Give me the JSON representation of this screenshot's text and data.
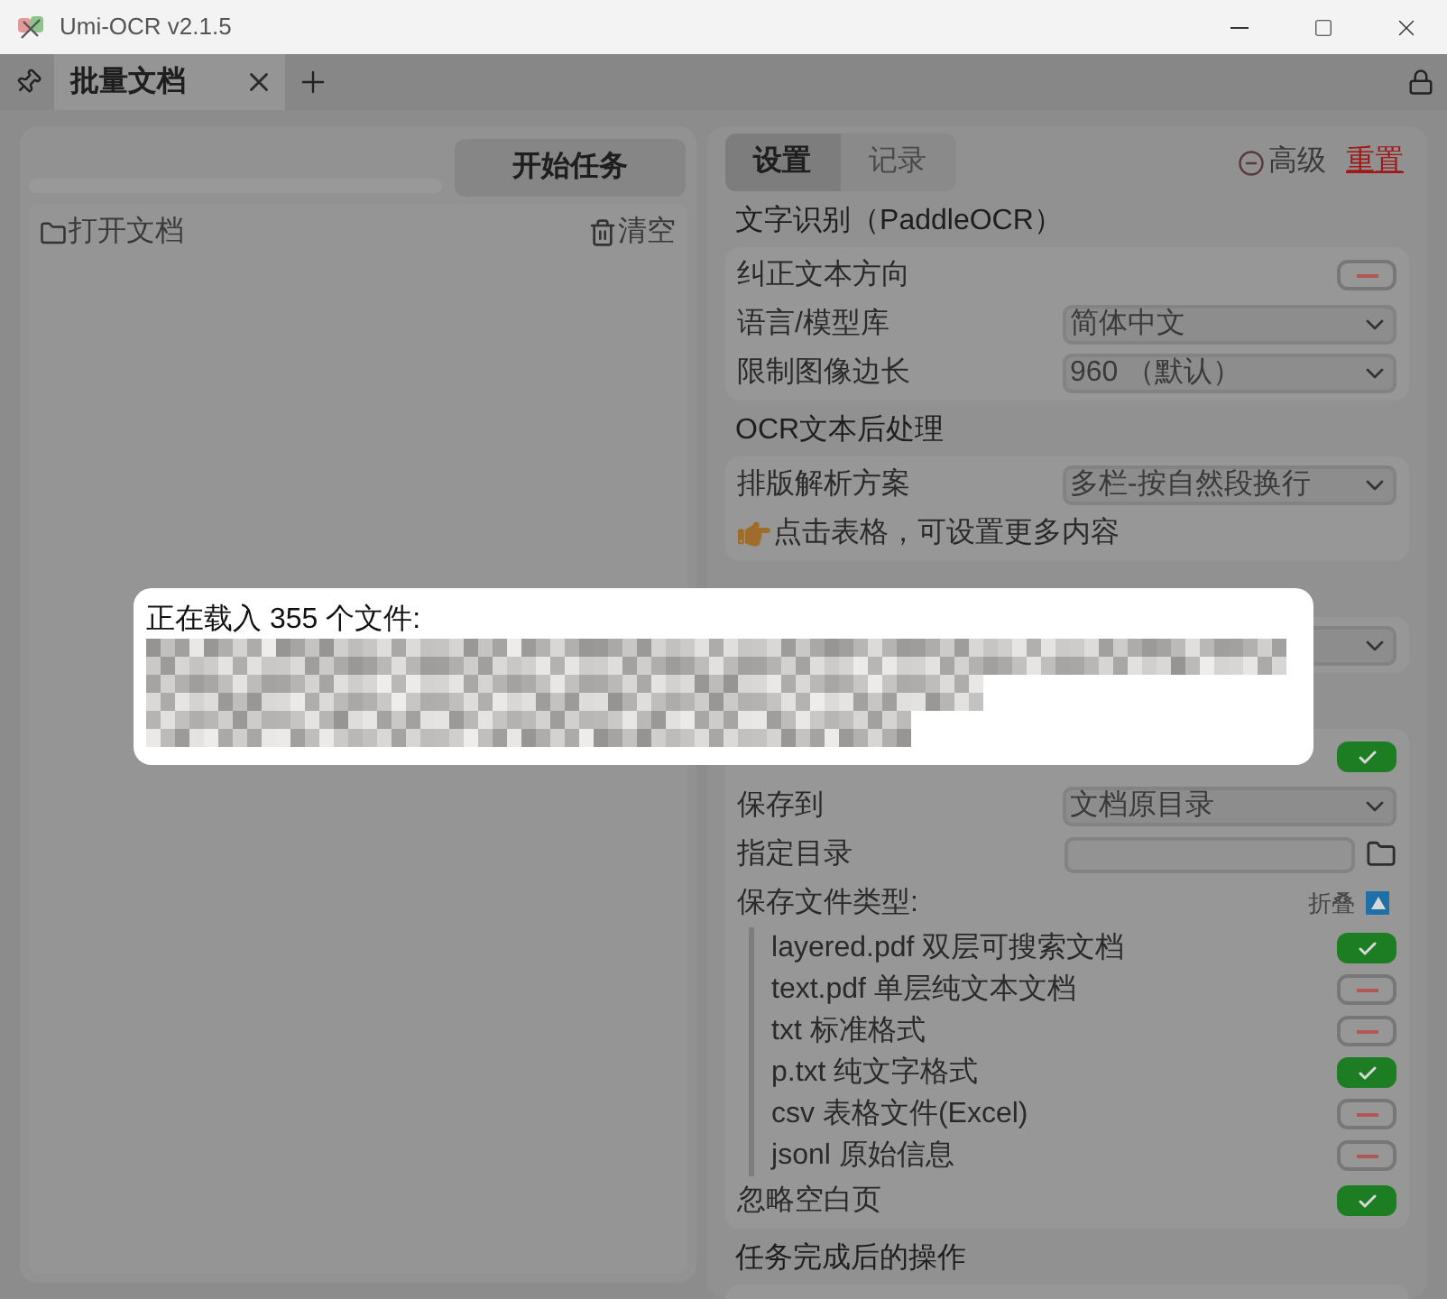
{
  "window": {
    "title": "Umi-OCR v2.1.5"
  },
  "tabs": [
    {
      "label": "批量文档",
      "selected": true
    }
  ],
  "task_panel": {
    "start_button": "开始任务",
    "progress": {
      "level": 0
    },
    "open_button": "打开文档",
    "clear_button": "清空"
  },
  "settings": {
    "tabs": [
      {
        "label": "设置",
        "selected": true
      },
      {
        "label": "记录",
        "selected": false
      }
    ],
    "advanced": "高级",
    "reset": "重置",
    "sections": [
      {
        "title": "文字识别（PaddleOCR）",
        "items": [
          {
            "kind": "toggle",
            "label": "纠正文本方向",
            "checked": false
          },
          {
            "kind": "select",
            "label": "语言/模型库",
            "value": "简体中文"
          },
          {
            "kind": "select",
            "label": "限制图像边长",
            "value": "960 （默认）"
          }
        ]
      },
      {
        "title": "OCR文本后处理",
        "items": [
          {
            "kind": "select",
            "label": "排版解析方案",
            "value": "多栏-按自然段换行"
          },
          {
            "kind": "hint",
            "text": "点击表格，可设置更多内容"
          }
        ]
      },
      {
        "items": [
          {
            "kind": "select"
          }
        ]
      },
      {
        "items": [
          {
            "kind": "toggle",
            "checked": true
          },
          {
            "kind": "select",
            "label": "保存到",
            "value": "文档原目录"
          },
          {
            "kind": "path",
            "label": "指定目录"
          },
          {
            "kind": "group",
            "label": "保存文件类型:",
            "action": "折叠",
            "expanded": true,
            "children": [
              {
                "kind": "toggle",
                "label": "layered.pdf 双层可搜索文档",
                "checked": true
              },
              {
                "kind": "toggle",
                "label": "text.pdf 单层纯文本文档",
                "checked": false
              },
              {
                "kind": "toggle",
                "label": "txt 标准格式",
                "checked": false
              },
              {
                "kind": "toggle",
                "label": "p.txt 纯文字格式",
                "checked": true
              },
              {
                "kind": "toggle",
                "label": "csv 表格文件(Excel)",
                "checked": false
              },
              {
                "kind": "toggle",
                "label": "jsonl 原始信息",
                "checked": false
              }
            ]
          },
          {
            "kind": "toggle",
            "label": "忽略空白页",
            "checked": true
          }
        ]
      },
      {
        "title": "任务完成后的操作"
      }
    ]
  },
  "loading_popup": {
    "message": "正在载入 355 个文件:"
  }
}
